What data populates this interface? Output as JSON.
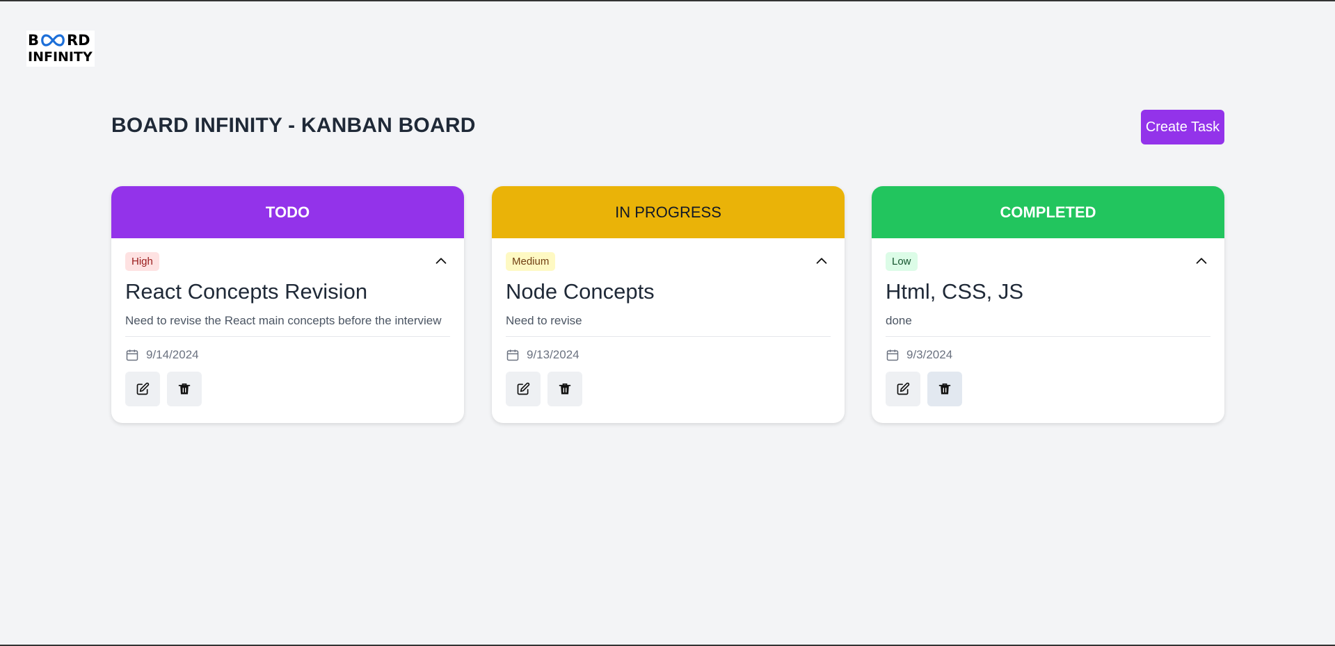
{
  "logo": {
    "line1_left": "B",
    "line1_right": "RD",
    "line2": "INFINITY"
  },
  "header": {
    "title": "BOARD INFINITY - KANBAN BOARD",
    "create_label": "Create Task"
  },
  "columns": [
    {
      "title": "TODO",
      "header_color": "#9333ea",
      "header_text_color": "#ffffff",
      "task": {
        "priority": "High",
        "priority_bg": "#fee2e2",
        "priority_fg": "#991b1b",
        "title": "React Concepts Revision",
        "description": "Need to revise the React main concepts before the interview",
        "date": "9/14/2024"
      }
    },
    {
      "title": "IN PROGRESS",
      "header_color": "#eab308",
      "header_text_color": "#111827",
      "task": {
        "priority": "Medium",
        "priority_bg": "#fef9c3",
        "priority_fg": "#713f12",
        "title": "Node Concepts",
        "description": "Need to revise",
        "date": "9/13/2024"
      }
    },
    {
      "title": "COMPLETED",
      "header_color": "#22c55e",
      "header_text_color": "#ffffff",
      "task": {
        "priority": "Low",
        "priority_bg": "#dcfce7",
        "priority_fg": "#14532d",
        "title": "Html, CSS, JS",
        "description": "done",
        "date": "9/3/2024"
      }
    }
  ],
  "icons": {
    "collapse": "chevron-up-icon",
    "date": "calendar-icon",
    "edit": "edit-icon",
    "delete": "trash-icon"
  }
}
